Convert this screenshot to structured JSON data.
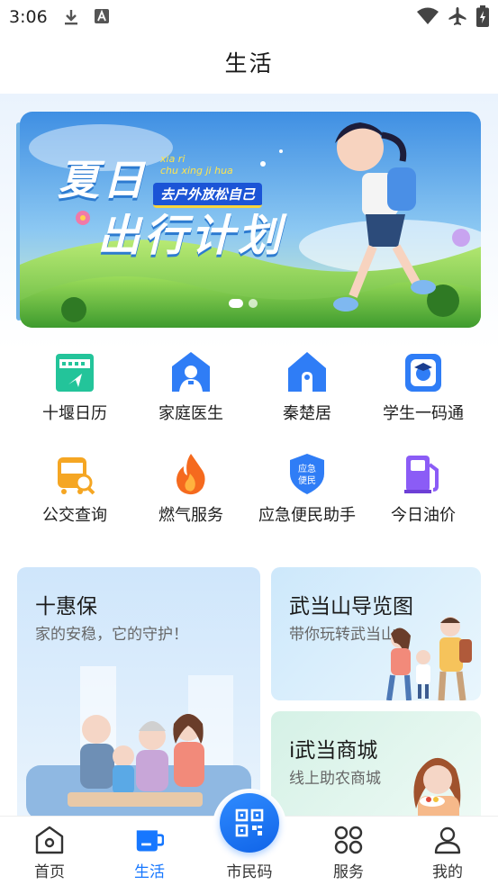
{
  "status_bar": {
    "time": "3:06"
  },
  "header": {
    "title": "生活"
  },
  "banner": {
    "title_line1": "夏日",
    "title_line2": "出行计划",
    "pinyin_line1": "xia ri",
    "pinyin_line2": "chu xing ji hua",
    "subtitle": "去户外放松自己"
  },
  "services": [
    {
      "label": "十堰日历",
      "icon": "calendar-icon",
      "color": "#23c49a"
    },
    {
      "label": "家庭医生",
      "icon": "doctor-icon",
      "color": "#2f7df6"
    },
    {
      "label": "秦楚居",
      "icon": "house-icon",
      "color": "#2f7df6"
    },
    {
      "label": "学生一码通",
      "icon": "student-icon",
      "color": "#2f7df6"
    },
    {
      "label": "公交查询",
      "icon": "bus-icon",
      "color": "#f5a623"
    },
    {
      "label": "燃气服务",
      "icon": "flame-icon",
      "color": "#f56a1e"
    },
    {
      "label": "应急便民助手",
      "icon": "shield-icon",
      "color": "#2f7df6"
    },
    {
      "label": "今日油价",
      "icon": "fuel-icon",
      "color": "#8b5cf6"
    }
  ],
  "cards": {
    "insurance": {
      "title": "十惠保",
      "subtitle": "家的安稳，它的守护！"
    },
    "wudang_map": {
      "title": "武当山导览图",
      "subtitle": "带你玩转武当山"
    },
    "wudang_mall": {
      "title": "i武当商城",
      "subtitle": "线上助农商城"
    }
  },
  "bottom_nav": {
    "home": "首页",
    "life": "生活",
    "citizen_code": "市民码",
    "services": "服务",
    "mine": "我的"
  },
  "colors": {
    "accent": "#1677ff"
  }
}
